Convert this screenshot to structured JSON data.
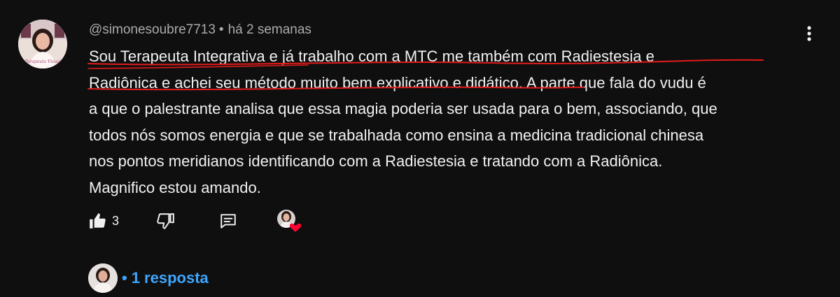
{
  "comment": {
    "author": "@simonesoubre7713",
    "separator": "•",
    "time": "há 2 semanas",
    "lines": [
      "Sou Terapeuta Integrativa e já trabalho com a  MTC me também com Radiestesia e",
      "Radiônica  e achei seu método muito bem explicativo e didático.  A parte que fala do vudu é",
      "a que o palestrante analisa que essa magia poderia ser usada para o bem, associando, que",
      "todos nós somos energia e que se trabalhada como ensina a medicina tradicional chinesa",
      "nos pontos meridianos identificando com a Radiestesia e tratando com a Radiônica.",
      "Magnifico estou amando."
    ],
    "avatar_caption": "Terapeuta Visual"
  },
  "actions": {
    "like_count": "3",
    "icons": [
      "thumbs-up-icon",
      "thumbs-down-icon",
      "reply-icon",
      "creator-heart-icon"
    ]
  },
  "replies": {
    "dot": "•",
    "label": "1 resposta"
  },
  "colors": {
    "background": "#0f0f0f",
    "text": "#f1f1f1",
    "muted": "#aaaaaa",
    "link": "#3ea6ff",
    "underline": "#e21b1b",
    "heart": "#ff0033"
  }
}
